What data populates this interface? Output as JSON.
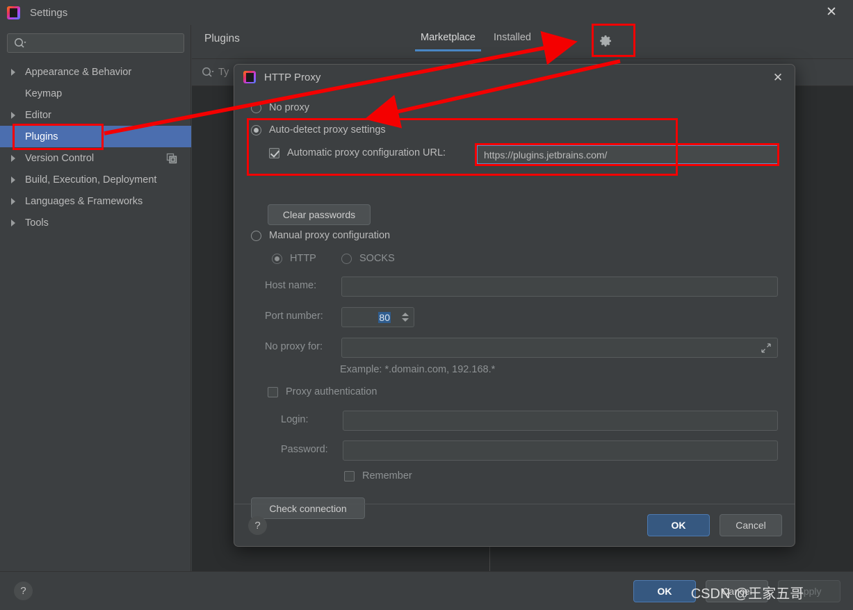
{
  "window": {
    "title": "Settings",
    "close_label": "✕",
    "app_icon": "intellij-idea-icon"
  },
  "sidebar": {
    "search": {
      "placeholder": "",
      "value": "",
      "icon": "search-icon"
    },
    "items": [
      {
        "label": "Appearance & Behavior",
        "expandable": true,
        "selected": false
      },
      {
        "label": "Keymap",
        "expandable": false,
        "selected": false
      },
      {
        "label": "Editor",
        "expandable": true,
        "selected": false
      },
      {
        "label": "Plugins",
        "expandable": false,
        "selected": true
      },
      {
        "label": "Version Control",
        "expandable": true,
        "selected": false,
        "right_icon": "copy-windows-icon"
      },
      {
        "label": "Build, Execution, Deployment",
        "expandable": true,
        "selected": false
      },
      {
        "label": "Languages & Frameworks",
        "expandable": true,
        "selected": false
      },
      {
        "label": "Tools",
        "expandable": true,
        "selected": false
      }
    ]
  },
  "plugins": {
    "title": "Plugins",
    "tabs": [
      {
        "label": "Marketplace",
        "active": true
      },
      {
        "label": "Installed",
        "active": false
      }
    ],
    "gear_icon": "gear-icon",
    "search": {
      "placeholder": "Ty",
      "icon": "search-icon"
    }
  },
  "footer": {
    "help_label": "?",
    "ok_label": "OK",
    "cancel_label": "Cancel",
    "apply_label": "Apply",
    "apply_enabled": false
  },
  "dialog": {
    "title": "HTTP Proxy",
    "icon": "intellij-idea-icon",
    "close_label": "✕",
    "no_proxy": {
      "label": "No proxy",
      "checked": false
    },
    "auto_detect": {
      "label": "Auto-detect proxy settings",
      "checked": true
    },
    "auto_config_url": {
      "label": "Automatic proxy configuration URL:",
      "checked": true,
      "value": "https://plugins.jetbrains.com/"
    },
    "clear_passwords_label": "Clear passwords",
    "manual": {
      "label": "Manual proxy configuration",
      "checked": false
    },
    "protocol": {
      "http": {
        "label": "HTTP",
        "checked": true
      },
      "socks": {
        "label": "SOCKS",
        "checked": false
      }
    },
    "host_name": {
      "label": "Host name:",
      "value": ""
    },
    "port_number": {
      "label": "Port number:",
      "value": "80"
    },
    "no_proxy_for": {
      "label": "No proxy for:",
      "value": "",
      "expand_icon": "expand-icon"
    },
    "example_text": "Example: *.domain.com, 192.168.*",
    "proxy_auth": {
      "label": "Proxy authentication",
      "checked": false
    },
    "login": {
      "label": "Login:",
      "value": ""
    },
    "password": {
      "label": "Password:",
      "value": ""
    },
    "remember": {
      "label": "Remember",
      "checked": false
    },
    "check_connection_label": "Check connection",
    "help_label": "?",
    "ok_label": "OK",
    "cancel_label": "Cancel"
  },
  "annotations": {
    "color": "#f40000",
    "boxes": [
      {
        "name": "plugins-sidebar-highlight"
      },
      {
        "name": "gear-button-highlight"
      },
      {
        "name": "auto-detect-section-highlight"
      },
      {
        "name": "auto-config-url-field-highlight"
      }
    ],
    "arrows": [
      {
        "name": "arrow-plugins-to-installed"
      },
      {
        "name": "arrow-gear-to-auto-detect"
      }
    ]
  },
  "watermark": {
    "text": "CSDN @王家五哥"
  },
  "colors": {
    "accent": "#4b6eaf",
    "tab_underline": "#4a88c7",
    "annotation_red": "#f40000",
    "panel_bg": "#3c3f41",
    "list_bg": "#2b2d2e",
    "field_bg": "#45494a",
    "primary_button": "#365880"
  }
}
